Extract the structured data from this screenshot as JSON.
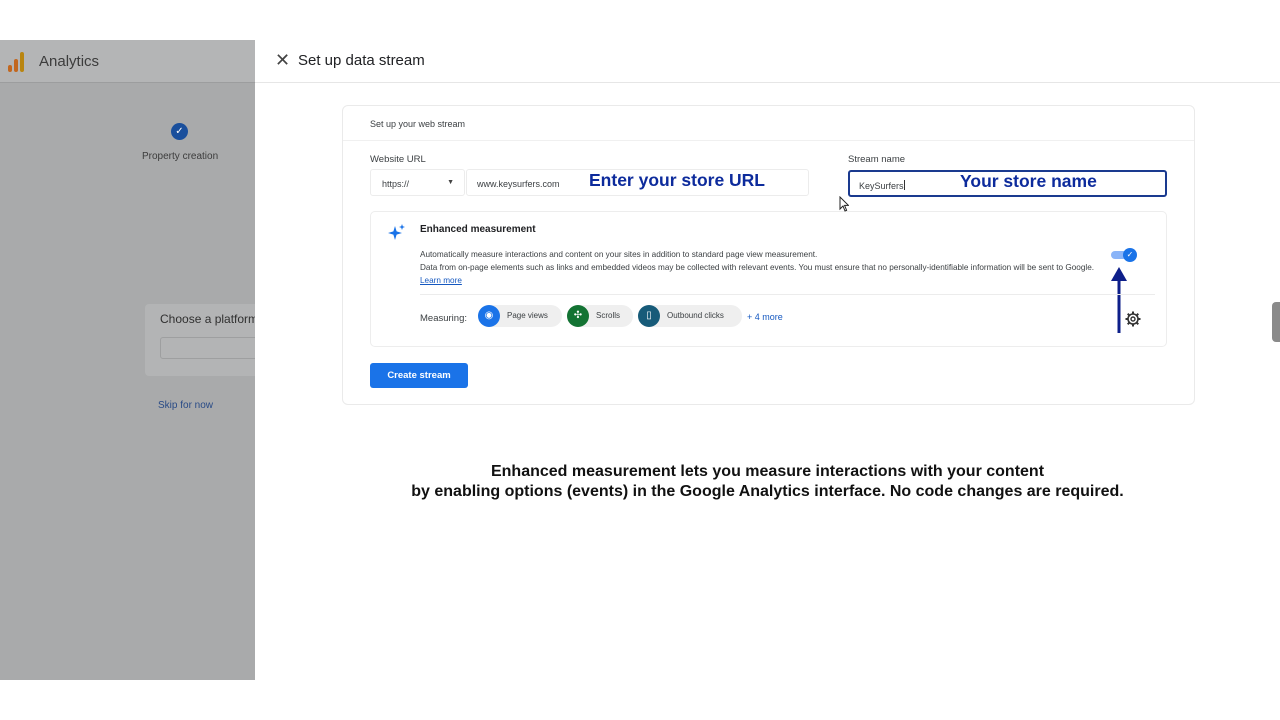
{
  "background_app": {
    "title": "Analytics",
    "step_label": "Property creation",
    "platform_label": "Choose a platform",
    "skip_link": "Skip for now"
  },
  "drawer": {
    "title": "Set up data stream",
    "card_heading": "Set up your web stream",
    "website_url_label": "Website URL",
    "protocol_value": "https://",
    "url_value": "www.keysurfers.com",
    "url_callout": "Enter your store URL",
    "stream_name_label": "Stream name",
    "stream_name_value": "KeySurfers",
    "stream_name_callout": "Your store name",
    "enhanced": {
      "title": "Enhanced measurement",
      "line1": "Automatically measure interactions and content on your sites in addition to standard page view measurement.",
      "line2": "Data from on-page elements such as links and embedded videos may be collected with relevant events. You must ensure that no personally-identifiable information will be sent to Google.",
      "learn_more": "Learn more",
      "toggle_on": true,
      "measuring_label": "Measuring:",
      "chips": [
        {
          "label": "Page views",
          "icon": "eye-icon",
          "color": "#1a73e8"
        },
        {
          "label": "Scrolls",
          "icon": "crosshair-icon",
          "color": "#137333"
        },
        {
          "label": "Outbound clicks",
          "icon": "mouse-icon",
          "color": "#175b79"
        }
      ],
      "more_link": "+ 4 more"
    },
    "create_button": "Create stream"
  },
  "caption": {
    "line1": "Enhanced measurement lets you measure interactions with your content",
    "line2": "by enabling options (events) in the Google Analytics interface. No code changes are required."
  },
  "colors": {
    "accent": "#1a73e8",
    "callout": "#0d2b9c",
    "annotation_arrow": "#0d1f8a"
  }
}
